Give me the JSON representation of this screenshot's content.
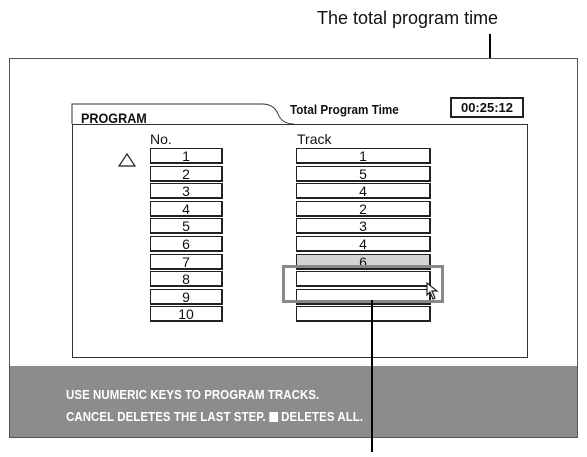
{
  "callouts": {
    "top": "The total program time"
  },
  "program": {
    "tab_label": "PROGRAM",
    "total_label": "Total Program Time",
    "total_time": "00:25:12",
    "col_no": "No.",
    "col_track": "Track",
    "rows": [
      {
        "no": "1",
        "track": "1"
      },
      {
        "no": "2",
        "track": "5"
      },
      {
        "no": "3",
        "track": "4"
      },
      {
        "no": "4",
        "track": "2"
      },
      {
        "no": "5",
        "track": "3"
      },
      {
        "no": "6",
        "track": "4"
      },
      {
        "no": "7",
        "track": "6"
      },
      {
        "no": "8",
        "track": ""
      },
      {
        "no": "9",
        "track": ""
      },
      {
        "no": "10",
        "track": ""
      }
    ],
    "selected_row": 7
  },
  "help": {
    "line1": "USE NUMERIC KEYS  TO PROGRAM TRACKS.",
    "line2a": "CANCEL DELETES THE LAST STEP.",
    "line2b": "DELETES ALL."
  }
}
